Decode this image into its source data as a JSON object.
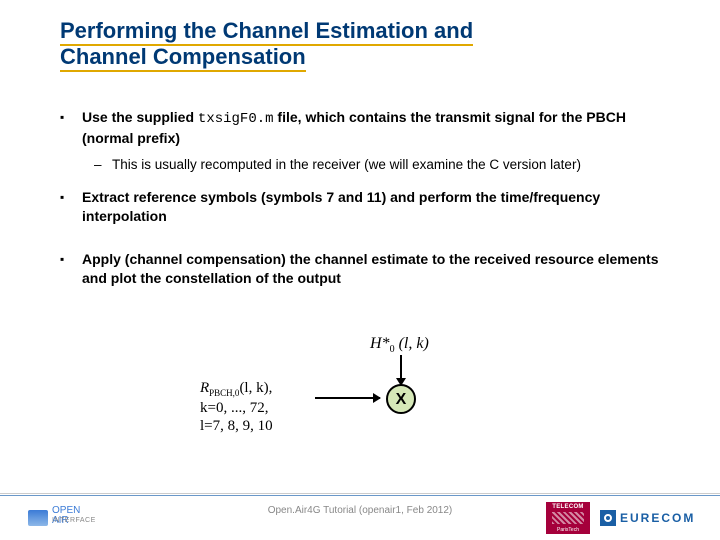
{
  "title": {
    "line1": "Performing the Channel Estimation and",
    "line2": "Channel Compensation"
  },
  "bullets": {
    "b1_pre": "Use the supplied ",
    "b1_code": "txsigF0.m",
    "b1_post": " file, which contains the transmit signal for the PBCH (normal prefix)",
    "b1_sub": "This is usually recomputed in the receiver (we will examine the C version later)",
    "b2": "Extract reference symbols (symbols 7 and 11) and perform the time/frequency interpolation",
    "b3": "Apply (channel compensation) the channel estimate to the received resource elements and plot the constellation of the output"
  },
  "diagram": {
    "H_label_pre": "H*",
    "H_label_sub": "0",
    "H_label_post": " (l, k)",
    "R_label_pre": "R",
    "R_label_sub": "PBCH,0",
    "R_label_args": "(l, k),",
    "R_line2": "k=0, ..., 72,",
    "R_line3": "l=7, 8, 9, 10",
    "mult": "X"
  },
  "footer": {
    "text": "Open.Air4G Tutorial (openair1, Feb 2012)",
    "openair_name": "OPEN AIR",
    "openair_sub": "INTERFACE",
    "telecom_top": "TELECOM",
    "telecom_bot": "ParisTech",
    "eurecom": "EURECOM"
  }
}
